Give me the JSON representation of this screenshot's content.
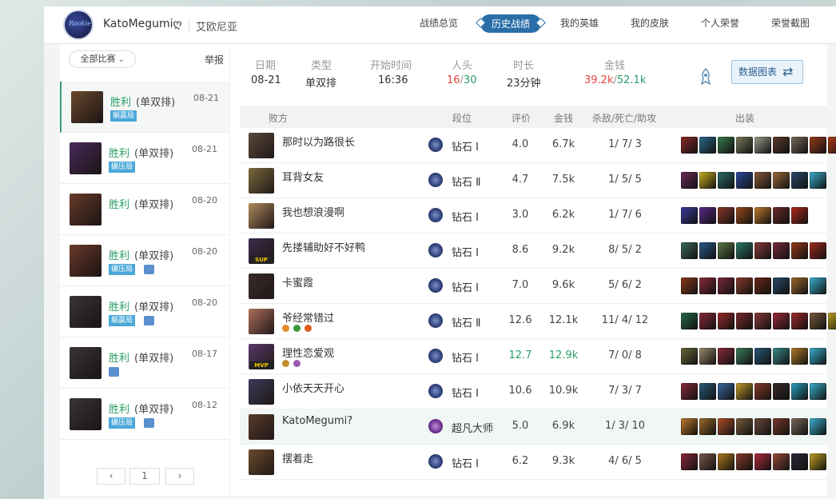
{
  "header": {
    "avatar_text": "Rookie",
    "username": "KatoMegumiღ",
    "server": "艾欧尼亚",
    "nav": [
      {
        "label": "战绩总览",
        "active": false
      },
      {
        "label": "历史战绩",
        "active": true
      },
      {
        "label": "我的英雄",
        "active": false
      },
      {
        "label": "我的皮肤",
        "active": false
      },
      {
        "label": "个人荣誉",
        "active": false
      },
      {
        "label": "荣誉截图",
        "active": false
      }
    ]
  },
  "left": {
    "filter_label": "全部比赛",
    "filter_icon": "chevron-down-icon",
    "report_label": "举报",
    "matches": [
      {
        "result": "胜利",
        "mode": "(单双排)",
        "date": "08-21",
        "tag": "躺赢局",
        "has_pic": false,
        "selected": true,
        "color": "#6b4a2c"
      },
      {
        "result": "胜利",
        "mode": "(单双排)",
        "date": "08-21",
        "tag": "碾压局",
        "has_pic": false,
        "selected": false,
        "color": "#4a2a5a"
      },
      {
        "result": "胜利",
        "mode": "(单双排)",
        "date": "08-20",
        "tag": "",
        "has_pic": false,
        "selected": false,
        "color": "#6a3a2a"
      },
      {
        "result": "胜利",
        "mode": "(单双排)",
        "date": "08-20",
        "tag": "碾压局",
        "has_pic": true,
        "selected": false,
        "color": "#6a3a2a"
      },
      {
        "result": "胜利",
        "mode": "(单双排)",
        "date": "08-20",
        "tag": "躺赢局",
        "has_pic": true,
        "selected": false,
        "color": "#3a3436"
      },
      {
        "result": "胜利",
        "mode": "(单双排)",
        "date": "08-17",
        "tag": "",
        "has_pic": true,
        "selected": false,
        "color": "#3a3436"
      },
      {
        "result": "胜利",
        "mode": "(单双排)",
        "date": "08-12",
        "tag": "碾压局",
        "has_pic": true,
        "selected": false,
        "color": "#3a3436"
      }
    ],
    "pager": {
      "prev": "‹",
      "page": "1",
      "next": "›"
    }
  },
  "summary": {
    "date_label": "日期",
    "date": "08-21",
    "type_label": "类型",
    "type": "单双排",
    "start_label": "开始时间",
    "start": "16:36",
    "kills_label": "人头",
    "kills_a": "16",
    "kills_sep": "/",
    "kills_b": "30",
    "duration_label": "时长",
    "duration": "23分钟",
    "gold_label": "金钱",
    "gold_a": "39.2k",
    "gold_sep": "/",
    "gold_b": "52.1k",
    "chart_button": "数据图表",
    "chart_icon": "swap-arrows-icon",
    "trophy_icon": "ward-icon"
  },
  "table": {
    "headers": {
      "team": "败方",
      "tier": "段位",
      "score": "评价",
      "gold": "金钱",
      "kda": "杀敌/死亡/助攻",
      "items": "出装"
    },
    "rows": [
      {
        "name": "那时以为路很长",
        "tier": "钻石 Ⅰ",
        "score": "4.0",
        "gold": "6.7k",
        "kda": "1/ 7/ 3",
        "champ": "#5a4a3a",
        "badge": "",
        "mini": [],
        "rank_type": "diamond",
        "score_highlight": false,
        "me": false,
        "items": [
          "#8a2a2a",
          "#2a6a8a",
          "#3a7a4a",
          "#7a7a5a",
          "#9a9a8a",
          "#5a3a2a",
          "#7a6a5a",
          "#9a3a1a",
          "#b03a1a"
        ]
      },
      {
        "name": "耳背女友",
        "tier": "钻石 Ⅱ",
        "score": "4.7",
        "gold": "7.5k",
        "kda": "1/ 5/ 5",
        "champ": "#7a6a3a",
        "badge": "",
        "mini": [],
        "rank_type": "diamond",
        "score_highlight": false,
        "me": false,
        "items": [
          "#6a2a5a",
          "#c9b020",
          "#2a6a6a",
          "#2a4aa0",
          "#8a5a3a",
          "#9a6a3a",
          "#2a4a6a",
          "#3ab0d0"
        ]
      },
      {
        "name": "我也想浪漫啊",
        "tier": "钻石 Ⅰ",
        "score": "3.0",
        "gold": "6.2k",
        "kda": "1/ 7/ 6",
        "champ": "#b08a5a",
        "badge": "",
        "mini": [],
        "rank_type": "diamond",
        "score_highlight": false,
        "me": false,
        "items": [
          "#3a3aa0",
          "#5a2a8a",
          "#8a3a2a",
          "#9a4a1a",
          "#c07a2a",
          "#6a2a2a",
          "#b02a1a"
        ]
      },
      {
        "name": "先搂辅助好不好鸭",
        "tier": "钻石 Ⅰ",
        "score": "8.6",
        "gold": "9.2k",
        "kda": "8/ 5/ 2",
        "champ": "#3a2a4a",
        "badge": "SUP",
        "mini": [],
        "rank_type": "diamond",
        "score_highlight": false,
        "me": false,
        "items": [
          "#3a6a5a",
          "#2a5a8a",
          "#5a7a4a",
          "#2a7a6a",
          "#8a3a3a",
          "#7a2a3a",
          "#9a3a1a",
          "#a02a1a"
        ]
      },
      {
        "name": "卡蜜霞",
        "tier": "钻石 Ⅰ",
        "score": "7.0",
        "gold": "9.6k",
        "kda": "5/ 6/ 2",
        "champ": "#3a2a2a",
        "badge": "",
        "mini": [],
        "rank_type": "diamond",
        "score_highlight": false,
        "me": false,
        "items": [
          "#8a3a1a",
          "#8a2a3a",
          "#7a2a3a",
          "#8a3a2a",
          "#6a2a1a",
          "#2a4a6a",
          "#9a6a2a",
          "#3ab0d0"
        ]
      },
      {
        "name": "爷经常错过",
        "tier": "钻石 Ⅱ",
        "score": "12.6",
        "gold": "12.1k",
        "kda": "11/ 4/ 12",
        "champ": "#b0705a",
        "badge": "",
        "mini": [
          "#e08a2a",
          "#3a9a3a",
          "#e05a1a"
        ],
        "rank_type": "diamond",
        "score_highlight": false,
        "me": false,
        "items": [
          "#2a6a4a",
          "#8a2a3a",
          "#9a2a2a",
          "#7a2a2a",
          "#8a3a3a",
          "#9a2a3a",
          "#a02a2a",
          "#7a5a3a",
          "#c0a020"
        ]
      },
      {
        "name": "理性恋爱观",
        "tier": "钻石 Ⅰ",
        "score": "12.7",
        "gold": "12.9k",
        "kda": "7/ 0/ 8",
        "champ": "#5a3a6a",
        "badge": "MVP",
        "mini": [
          "#c0902a",
          "#9a5ab0"
        ],
        "rank_type": "diamond",
        "score_highlight": true,
        "me": false,
        "items": [
          "#6a6a3a",
          "#9a8a6a",
          "#8a2a3a",
          "#3a7a5a",
          "#2a5a7a",
          "#3a8a8a",
          "#b07a2a",
          "#3ab0d0"
        ]
      },
      {
        "name": "小依天天开心",
        "tier": "钻石 Ⅰ",
        "score": "10.6",
        "gold": "10.9k",
        "kda": "7/ 3/ 7",
        "champ": "#3a3a5a",
        "badge": "",
        "mini": [],
        "rank_type": "diamond",
        "score_highlight": false,
        "me": false,
        "items": [
          "#8a2a3a",
          "#2a5a7a",
          "#3a6aa0",
          "#c09a2a",
          "#8a3a2a",
          "#3a2a2a",
          "#2aa0c0",
          "#3ab0d0"
        ]
      },
      {
        "name": "KatoMegumi?",
        "tier": "超凡大师",
        "score": "5.0",
        "gold": "6.9k",
        "kda": "1/ 3/ 10",
        "champ": "#5a3a2a",
        "badge": "",
        "mini": [],
        "rank_type": "master",
        "score_highlight": false,
        "me": true,
        "items": [
          "#c07a2a",
          "#9a6a2a",
          "#b0502a",
          "#7a5a3a",
          "#6a4a3a",
          "#7a3a2a",
          "#7a6a5a",
          "#3ab0d0"
        ]
      },
      {
        "name": "摆着走",
        "tier": "钻石 Ⅰ",
        "score": "6.2",
        "gold": "9.3k",
        "kda": "4/ 6/ 5",
        "champ": "#6a4a2a",
        "badge": "",
        "mini": [],
        "rank_type": "diamond",
        "score_highlight": false,
        "me": false,
        "items": [
          "#8a2a3a",
          "#7a5a4a",
          "#b07a1a",
          "#8a3a2a",
          "#b02a3a",
          "#9a4a3a",
          "#2a2a3a",
          "#c0a020"
        ]
      }
    ]
  }
}
